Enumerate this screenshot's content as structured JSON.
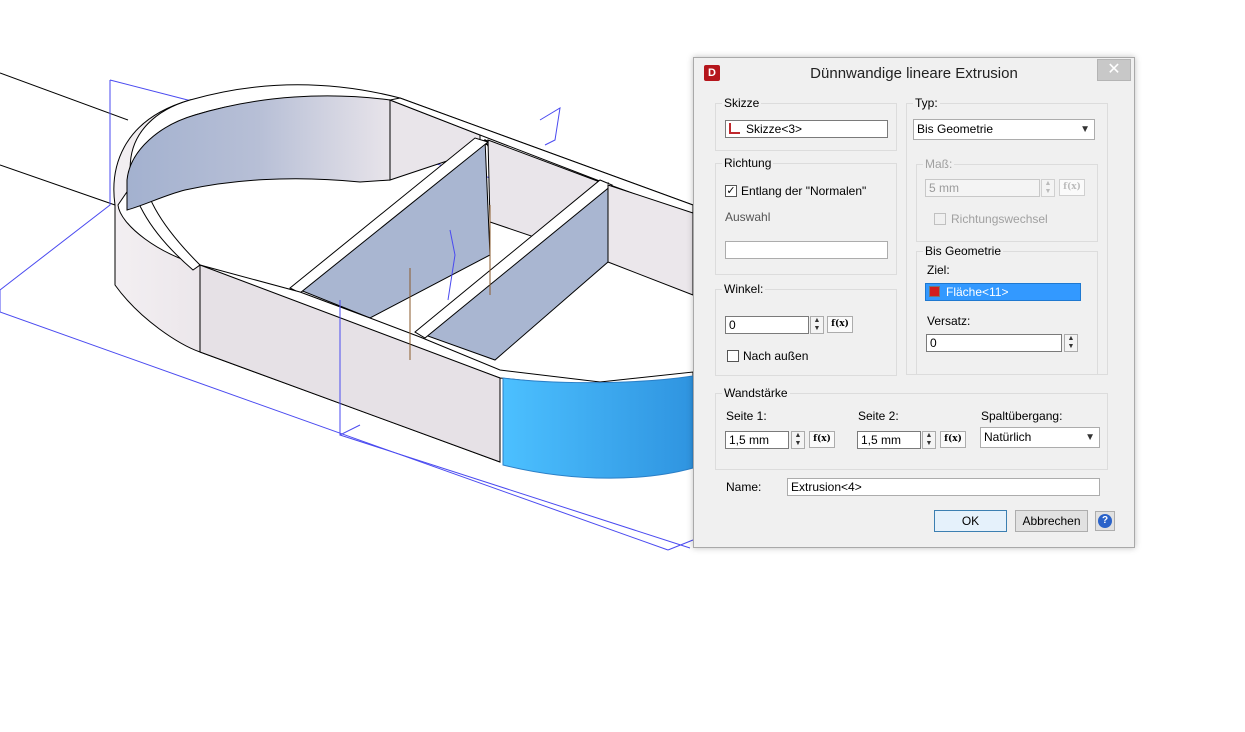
{
  "dialog": {
    "title": "Dünnwandige lineare Extrusion",
    "app_icon": "D",
    "close_symbol": "✕",
    "skizze": {
      "group_label": "Skizze",
      "value": "Skizze<3>"
    },
    "richtung": {
      "group_label": "Richtung",
      "checkbox_label": "Entlang der \"Normalen\"",
      "checked": true,
      "auswahl_label": "Auswahl",
      "auswahl_value": ""
    },
    "winkel": {
      "group_label": "Winkel:",
      "value": "0",
      "fx_label": "f(x)",
      "nach_aussen_label": "Nach außen",
      "nach_aussen_checked": false
    },
    "typ": {
      "group_label": "Typ:",
      "selected": "Bis Geometrie"
    },
    "mass": {
      "group_label": "Maß:",
      "value": "5 mm",
      "fx_label": "f(x)",
      "richtungswechsel_label": "Richtungswechsel",
      "enabled": false
    },
    "bis_geometrie": {
      "group_label": "Bis Geometrie",
      "ziel_label": "Ziel:",
      "ziel_value": "Fläche<11>",
      "versatz_label": "Versatz:",
      "versatz_value": "0"
    },
    "wandstaerke": {
      "group_label": "Wandstärke",
      "seite1_label": "Seite 1:",
      "seite1_value": "1,5 mm",
      "seite2_label": "Seite 2:",
      "seite2_value": "1,5 mm",
      "fx_label": "f(x)",
      "spalt_label": "Spaltübergang:",
      "spalt_selected": "Natürlich"
    },
    "name": {
      "label": "Name:",
      "value": "Extrusion<4>"
    },
    "buttons": {
      "ok": "OK",
      "cancel": "Abbrechen",
      "help": "?"
    }
  },
  "colors": {
    "highlight_face": "#3db2ff",
    "selection": "#3399ff",
    "wall": "#e6e1e6",
    "inner_face": "#a8b6d2",
    "construction_line": "#4a4af0"
  }
}
